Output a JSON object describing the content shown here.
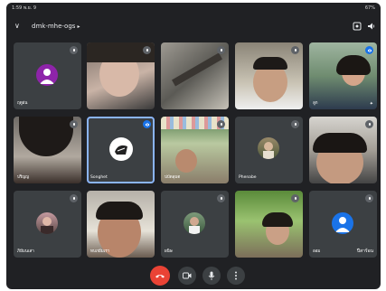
{
  "status": {
    "time": "1:59",
    "date": "พ.ย. 9",
    "right": "67%"
  },
  "header": {
    "meeting_code": "dmk-mhe-ogs"
  },
  "tiles": [
    {
      "name": "ฤดูฝน"
    },
    {
      "name": ""
    },
    {
      "name": ""
    },
    {
      "name": ""
    },
    {
      "name": "ลูก"
    },
    {
      "name": "ปริญญ"
    },
    {
      "name": "Songhet"
    },
    {
      "name": "ปบัดลุมต"
    },
    {
      "name": "Phenabe"
    },
    {
      "name": ""
    },
    {
      "name": "ภิมีมนเสา"
    },
    {
      "name": "ทบภมีมเรา"
    },
    {
      "name": "ผนิษ"
    },
    {
      "name": ""
    },
    {
      "name": "ออม"
    }
  ],
  "tile_corner_label": "ปีสาร้อน",
  "colors": {
    "bg": "#202124",
    "tile": "#3c4043",
    "end_call": "#ea4335",
    "accent": "#1a73e8"
  }
}
